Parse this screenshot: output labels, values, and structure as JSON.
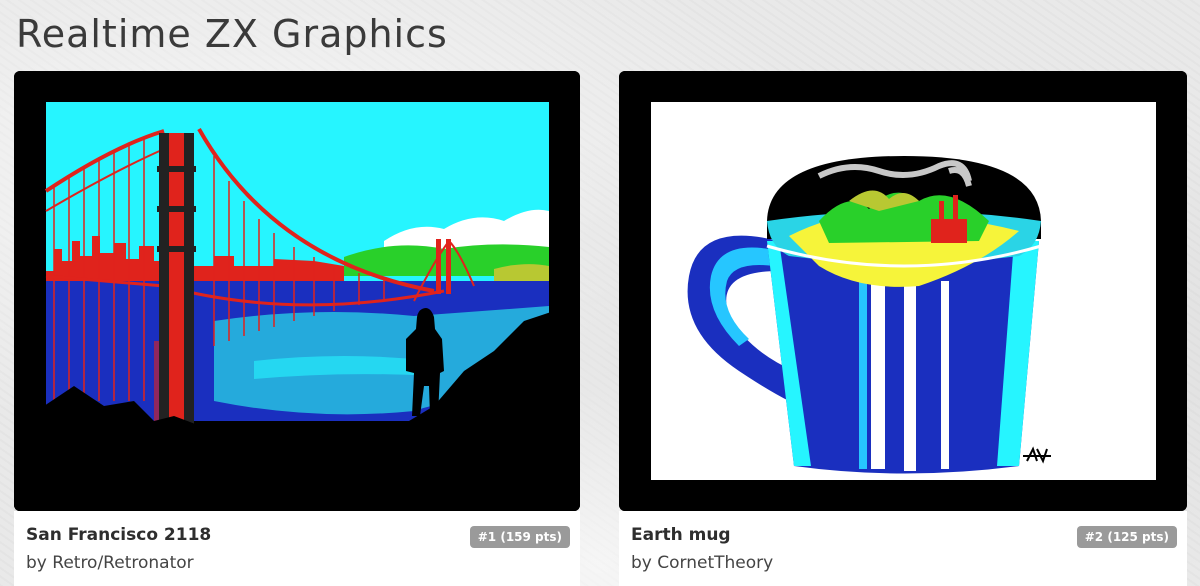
{
  "page": {
    "title": "Realtime ZX Graphics"
  },
  "cards": [
    {
      "title": "San Francisco 2118",
      "by_prefix": "by",
      "author": "Retro/Retronator",
      "rank": "#1 (159 pts)"
    },
    {
      "title": "Earth mug",
      "by_prefix": "by",
      "author": "CornetTheory",
      "rank": "#2 (125 pts)"
    }
  ],
  "colors": {
    "page_bg": "#e9e9e9",
    "title_text": "#3a3a3a",
    "badge_bg": "#9a9a9a",
    "frame": "#000000",
    "zx_cyan": "#26f5ff",
    "zx_red": "#e0231c",
    "zx_blue": "#1a2fbf",
    "zx_green": "#29d02a",
    "zx_yellow": "#f6f43a"
  }
}
